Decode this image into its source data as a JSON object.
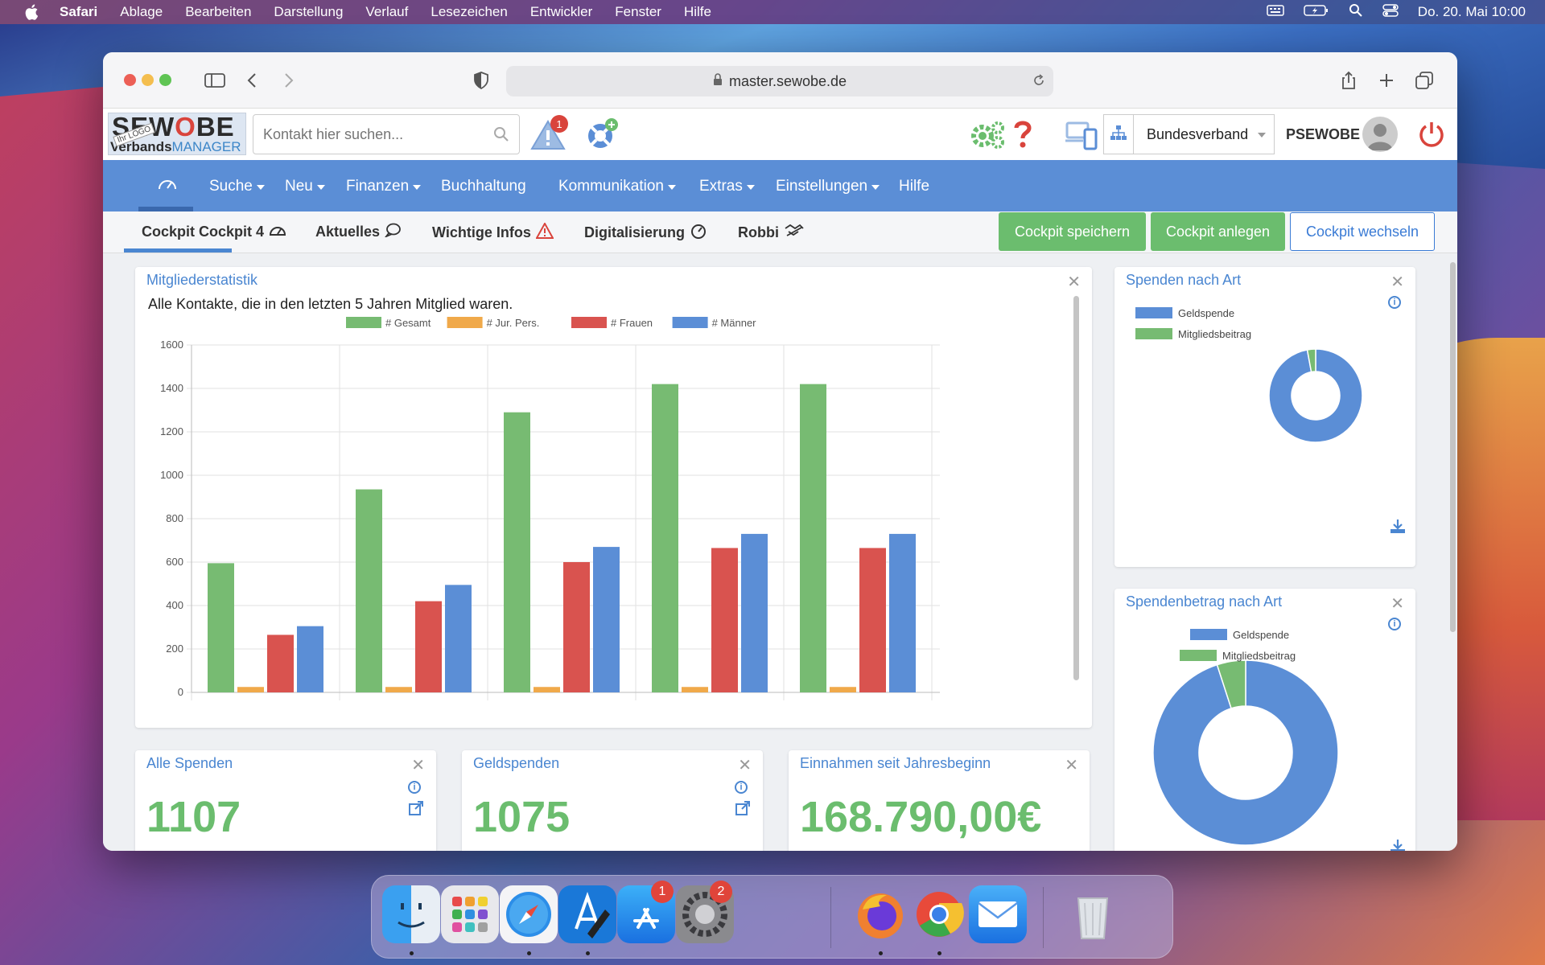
{
  "menubar": {
    "app": "Safari",
    "items": [
      "Ablage",
      "Bearbeiten",
      "Darstellung",
      "Verlauf",
      "Lesezeichen",
      "Entwickler",
      "Fenster",
      "Hilfe"
    ],
    "datetime": "Do. 20. Mai  10:00"
  },
  "browser": {
    "url": "master.sewobe.de"
  },
  "app": {
    "logo_top": "SEWOBE",
    "logo_sub_left": "Verbands",
    "logo_sub_right": "MANAGER",
    "logo_stamp": "Ihr LOGO",
    "search_placeholder": "Kontakt hier suchen...",
    "alert_count": "1",
    "org_select": "Bundesverband",
    "user": "PSEWOBE"
  },
  "nav": {
    "items": [
      {
        "label": "Suche",
        "dropdown": true
      },
      {
        "label": "Neu",
        "dropdown": true
      },
      {
        "label": "Finanzen",
        "dropdown": true
      },
      {
        "label": "Buchhaltung",
        "dropdown": false
      },
      {
        "label": "Kommunikation",
        "dropdown": true
      },
      {
        "label": "Extras",
        "dropdown": true
      },
      {
        "label": "Einstellungen",
        "dropdown": true
      },
      {
        "label": "Hilfe",
        "dropdown": false
      }
    ]
  },
  "tabs": {
    "items": [
      "Cockpit Cockpit 4",
      "Aktuelles",
      "Wichtige Infos",
      "Digitalisierung",
      "Robbi"
    ],
    "active": "Cockpit Cockpit 4",
    "save": "Cockpit speichern",
    "create": "Cockpit anlegen",
    "switch": "Cockpit wechseln"
  },
  "widgets": {
    "members": {
      "title": "Mitgliederstatistik",
      "subtitle": "Alle Kontakte, die in den letzten 5 Jahren Mitglied waren."
    },
    "donations_type": {
      "title": "Spenden nach Art"
    },
    "donation_amount_type": {
      "title": "Spendenbetrag nach Art"
    },
    "all_donations": {
      "title": "Alle Spenden",
      "value": "1107"
    },
    "money_donations": {
      "title": "Geldspenden",
      "value": "1075"
    },
    "income": {
      "title": "Einnahmen seit Jahresbeginn",
      "value": "168.790,00€"
    }
  },
  "chart_data": [
    {
      "type": "bar",
      "categories": [
        "",
        "",
        "",
        "",
        ""
      ],
      "series": [
        {
          "name": "# Gesamt",
          "color": "#77bb72",
          "values": [
            595,
            935,
            1290,
            1420,
            1420
          ]
        },
        {
          "name": "# Jur. Pers.",
          "color": "#f0a94a",
          "values": [
            25,
            25,
            25,
            25,
            25
          ]
        },
        {
          "name": "# Frauen",
          "color": "#d9534f",
          "values": [
            265,
            420,
            600,
            665,
            665
          ]
        },
        {
          "name": "# Männer",
          "color": "#5b8ed6",
          "values": [
            305,
            495,
            670,
            730,
            730
          ]
        }
      ],
      "ylim": [
        0,
        1600
      ],
      "yticks": [
        0,
        200,
        400,
        600,
        800,
        1000,
        1200,
        1400,
        1600
      ],
      "legend": "top",
      "grid": true
    },
    {
      "type": "pie",
      "title": "Spenden nach Art",
      "labels": [
        "Geldspende",
        "Mitgliedsbeitrag"
      ],
      "colors": [
        "#5b8ed6",
        "#77bb72"
      ],
      "values": [
        1075,
        32
      ],
      "legend": "top-left"
    },
    {
      "type": "pie",
      "title": "Spendenbetrag nach Art",
      "labels": [
        "Geldspende",
        "Mitgliedsbeitrag"
      ],
      "colors": [
        "#5b8ed6",
        "#77bb72"
      ],
      "values": [
        95,
        5
      ],
      "legend": "top"
    }
  ],
  "dock": {
    "apps": [
      "finder-icon",
      "launchpad-icon",
      "safari-icon",
      "xcode-icon",
      "app-store-icon",
      "system-preferences-icon",
      "firefox-icon",
      "chrome-icon",
      "mail-icon",
      "trash-icon"
    ],
    "app_store_badge": "1",
    "settings_badge": "2"
  }
}
